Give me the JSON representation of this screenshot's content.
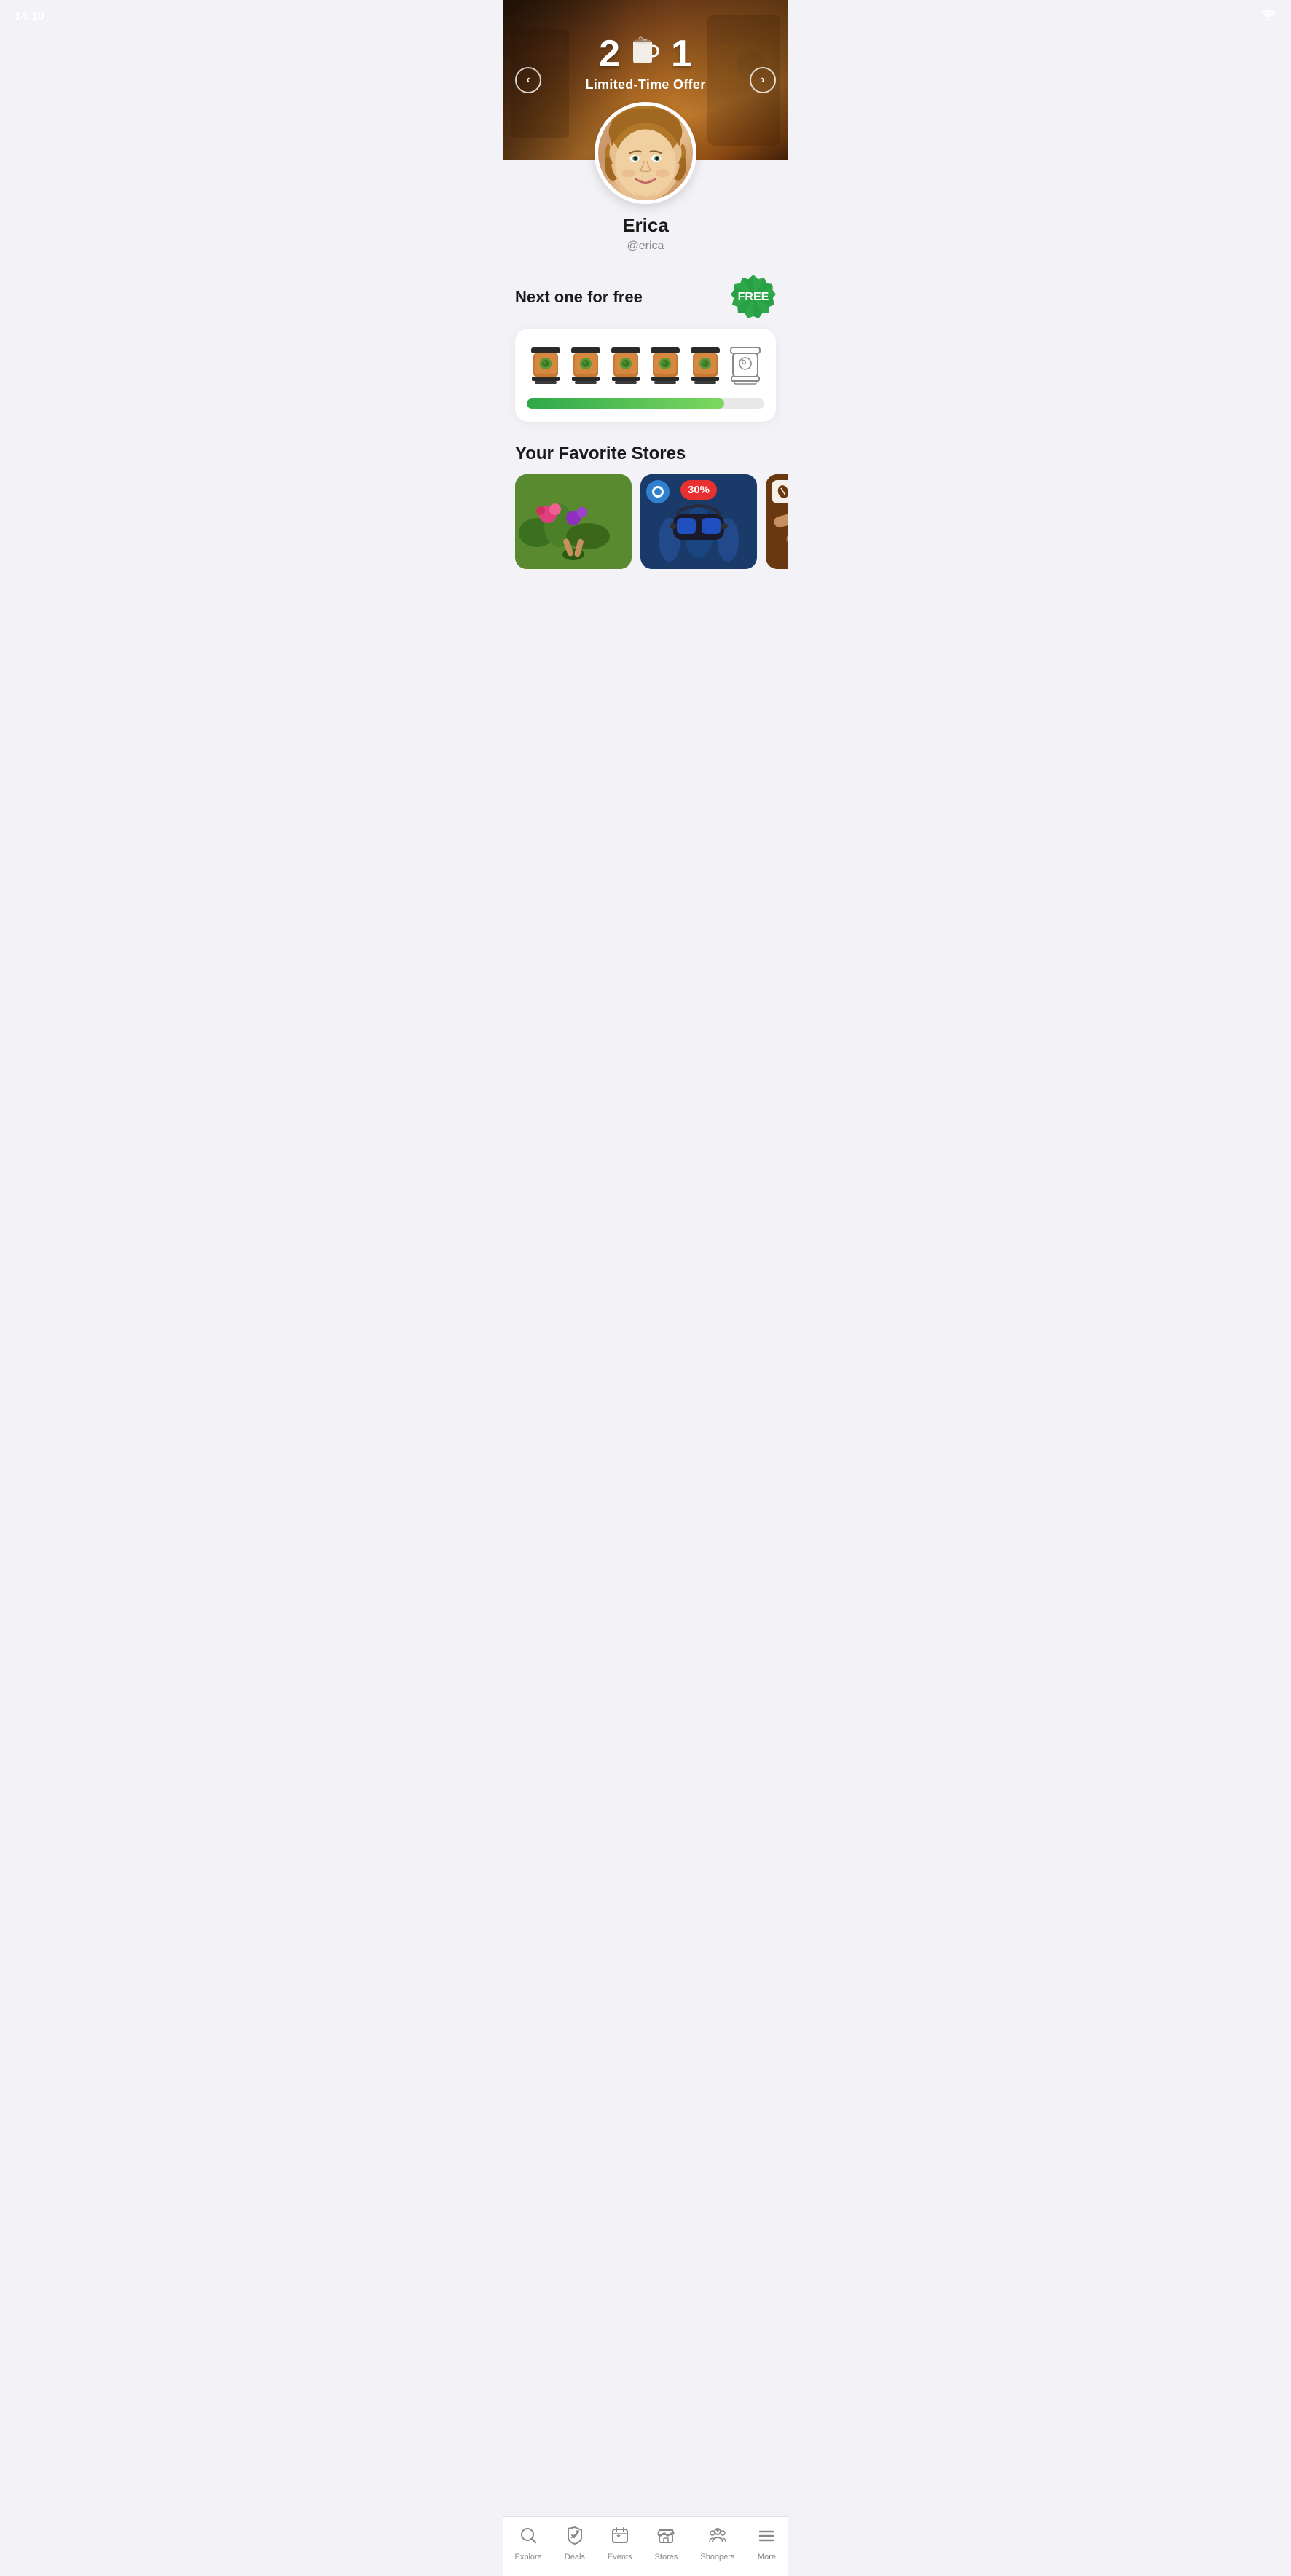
{
  "statusBar": {
    "time": "14:10",
    "wifiIcon": "wifi"
  },
  "hero": {
    "promo": {
      "number1": "2",
      "number2": "1",
      "subtitle": "Limited-Time Offer"
    },
    "prevButton": "‹",
    "nextButton": "›"
  },
  "profile": {
    "name": "Erica",
    "handle": "@erica"
  },
  "loyalty": {
    "title": "Next one for free",
    "freeBadge": "FREE",
    "cups": [
      {
        "filled": true,
        "id": 1
      },
      {
        "filled": true,
        "id": 2
      },
      {
        "filled": true,
        "id": 3
      },
      {
        "filled": true,
        "id": 4
      },
      {
        "filled": true,
        "id": 5
      },
      {
        "filled": false,
        "id": 6
      }
    ],
    "progressPercent": 83
  },
  "stores": {
    "title": "Your Favorite Stores",
    "items": [
      {
        "id": 1,
        "bg": "green",
        "badge": null,
        "logoType": "none"
      },
      {
        "id": 2,
        "bg": "blue",
        "badge": "30%",
        "logoType": "circle"
      },
      {
        "id": 3,
        "bg": "brown",
        "badge": null,
        "logoType": "bean"
      }
    ]
  },
  "bottomNav": {
    "items": [
      {
        "label": "Explore",
        "icon": "search",
        "active": false
      },
      {
        "label": "Deals",
        "icon": "deals",
        "active": false
      },
      {
        "label": "Events",
        "icon": "events",
        "active": false
      },
      {
        "label": "Stores",
        "icon": "stores",
        "active": false
      },
      {
        "label": "Shoopers",
        "icon": "shoopers",
        "active": false
      },
      {
        "label": "More",
        "icon": "more",
        "active": false
      }
    ]
  }
}
